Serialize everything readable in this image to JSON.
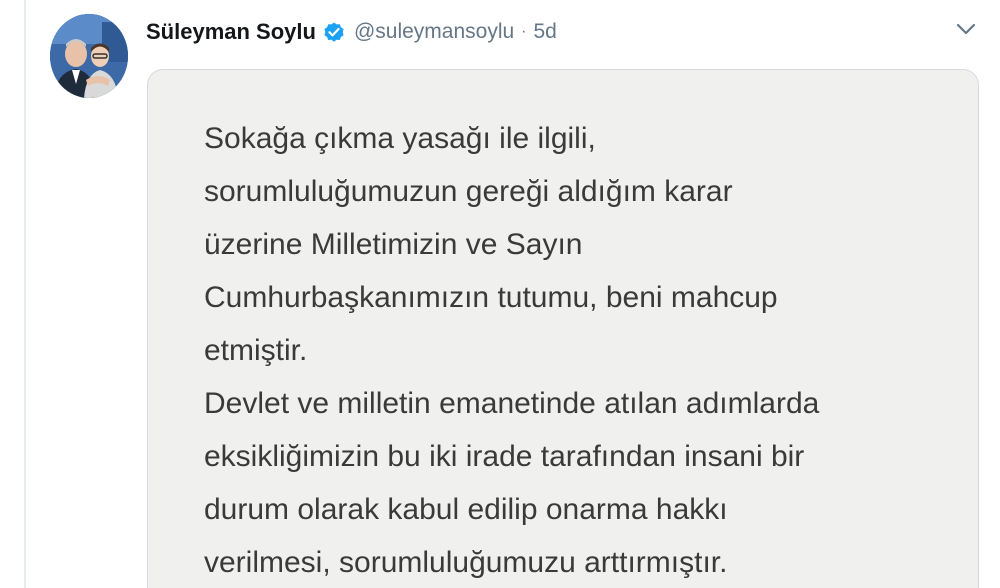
{
  "tweet": {
    "author": {
      "display_name": "Süleyman Soylu",
      "handle": "@suleymansoylu",
      "verified": true,
      "avatar_icon": "profile-photo"
    },
    "separator": "·",
    "time": "5d",
    "menu_icon": "chevron-down-icon",
    "media": {
      "lines": [
        "Sokağa çıkma yasağı ile ilgili,",
        "sorumluluğumuzun gereği aldığım karar",
        "üzerine Milletimizin ve Sayın",
        "Cumhurbaşkanımızın tutumu, beni mahcup",
        "etmiştir.",
        "Devlet ve milletin emanetinde atılan adımlarda",
        "eksikliğimizin bu iki irade tarafından insani bir",
        "durum olarak kabul edilip onarma hakkı",
        "verilmesi, sorumluluğumuzu arttırmıştır."
      ]
    }
  },
  "colors": {
    "name": "#14171a",
    "secondary": "#657786",
    "verified_badge": "#1da1f2",
    "card_background": "#f0f0ef",
    "card_text": "#3a3a3a"
  }
}
